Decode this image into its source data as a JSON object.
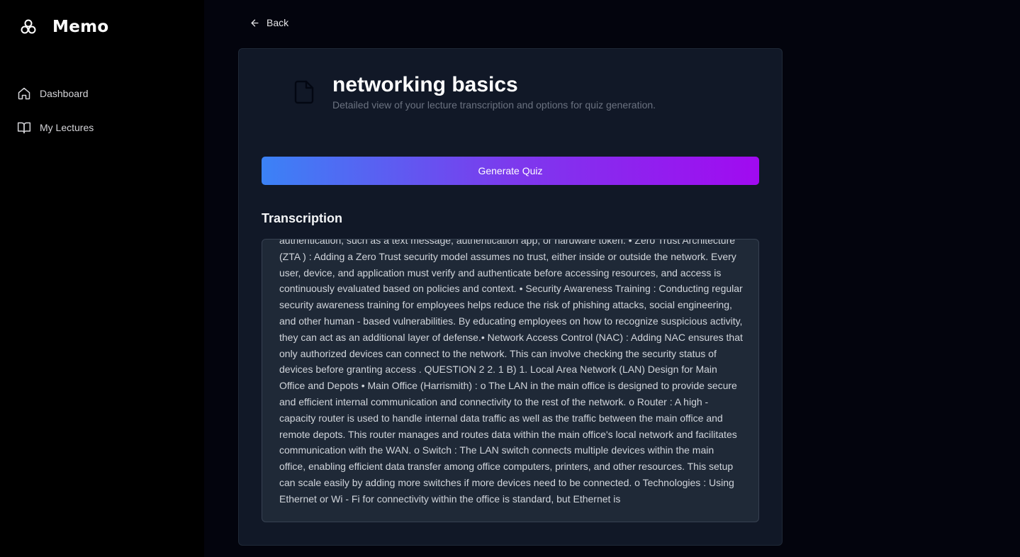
{
  "app": {
    "name": "Memo"
  },
  "sidebar": {
    "items": [
      {
        "label": "Dashboard",
        "icon": "home-icon"
      },
      {
        "label": "My Lectures",
        "icon": "book-icon"
      }
    ]
  },
  "back": {
    "label": "Back"
  },
  "lecture": {
    "title": "networking basics",
    "subtitle": "Detailed view of your lecture transcription and options for quiz generation."
  },
  "actions": {
    "generate_quiz_label": "Generate Quiz"
  },
  "transcription": {
    "heading": "Transcription",
    "text": "authentication, such as a text message, authentication app, or hardware token. • Zero Trust Architecture (ZTA ) : Adding a Zero Trust security model assumes no trust, either inside or outside the network. Every user, device, and application must verify and authenticate before accessing resources, and access is continuously evaluated based on policies and context. • Security Awareness Training : Conducting regular security awareness training for employees helps reduce the risk of phishing attacks, social engineering, and other human - based vulnerabilities. By educating employees on how to recognize suspicious activity, they can act as an additional layer of defense.• Network Access Control (NAC) : Adding NAC ensures that only authorized devices can connect to the network. This can involve checking the security status of devices before granting access . QUESTION 2 2. 1 B) 1. Local Area Network (LAN) Design for Main Office and Depots • Main Office (Harrismith) : o The LAN in the main office is designed to provide secure and efficient internal communication and connectivity to the rest of the network. o Router : A high - capacity router is used to handle internal data traffic as well as the traffic between the main office and remote depots. This router manages and routes data within the main office's local network and facilitates communication with the WAN. o Switch : The LAN switch connects multiple devices within the main office, enabling efficient data transfer among office computers, printers, and other resources. This setup can scale easily by adding more switches if more devices need to be connected. o Technologies : Using Ethernet or Wi - Fi for connectivity within the office is standard, but Ethernet is"
  },
  "colors": {
    "sidebar_bg": "#000000",
    "page_bg": "#03040d",
    "card_bg": "#111827",
    "gradient_start": "#3b82f6",
    "gradient_end": "#a10af0"
  }
}
